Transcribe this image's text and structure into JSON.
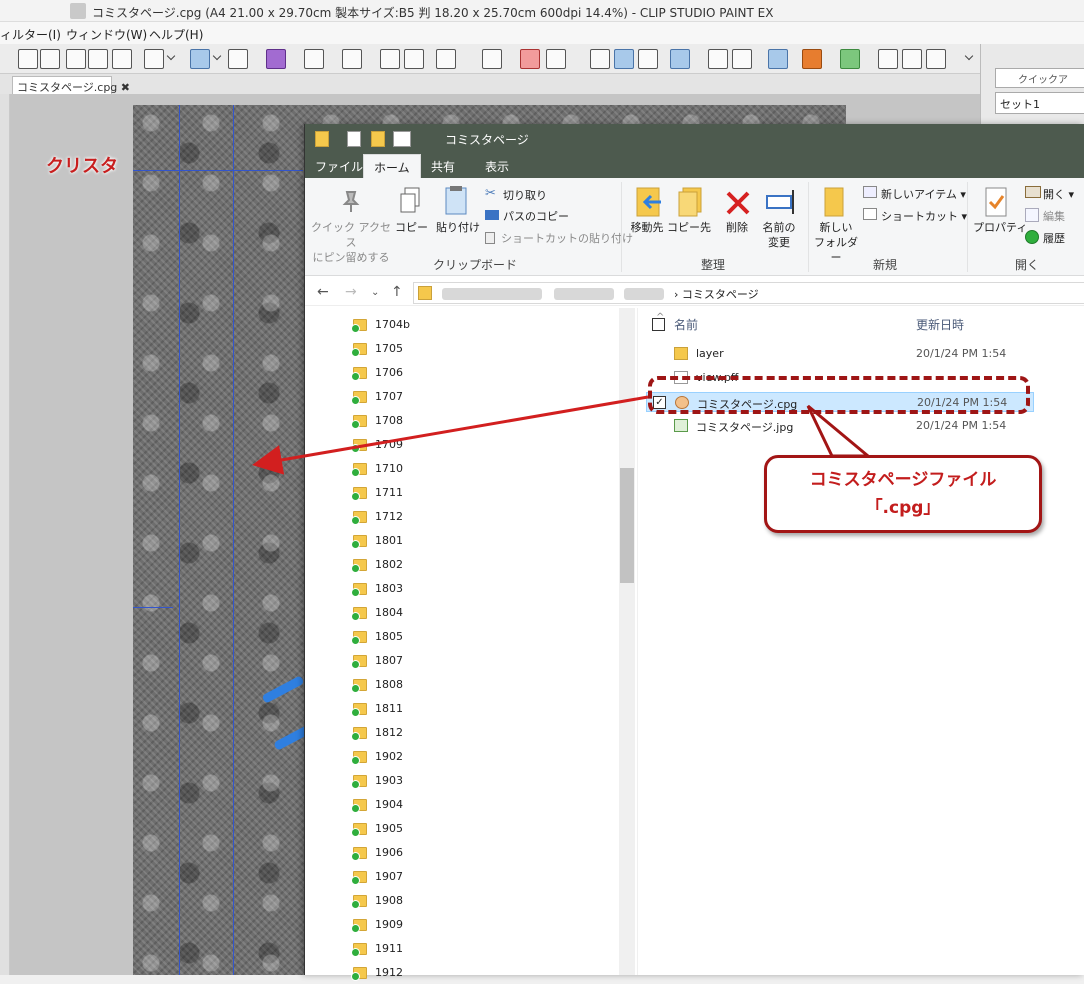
{
  "window": {
    "title": "コミスタページ.cpg (A4 21.00 x 29.70cm 製本サイズ:B5 判 18.20 x 25.70cm 600dpi 14.4%) - CLIP STUDIO PAINT EX"
  },
  "menu": {
    "items": [
      "ィルター(I)",
      "ウィンドウ(W)",
      "ヘルプ(H)"
    ]
  },
  "canvas": {
    "tab_label": "コミスタページ.cpg ✖"
  },
  "right_panel": {
    "search_placeholder": "クイックア",
    "set_label": "セット1"
  },
  "annotation": {
    "left_label": "クリスタ",
    "callout_line1": "コミスタページファイル",
    "callout_line2": "「.cpg」",
    "accent_color": "#c31d1d"
  },
  "explorer": {
    "title": "コミスタページ",
    "tabs": [
      "ファイル",
      "ホーム",
      "共有",
      "表示"
    ],
    "active_tab": "ホーム",
    "ribbon": {
      "clipboard": {
        "pin": "クイック アクセス\nにピン留めする",
        "copy": "コピー",
        "paste": "貼り付け",
        "cut": "切り取り",
        "copy_path": "パスのコピー",
        "paste_shortcut": "ショートカットの貼り付け",
        "group": "クリップボード"
      },
      "organize": {
        "move_to": "移動先",
        "copy_to": "コピー先",
        "delete": "削除",
        "rename": "名前の\n変更",
        "group": "整理"
      },
      "new": {
        "new_folder": "新しい\nフォルダー",
        "new_item": "新しいアイテム ▾",
        "shortcut": "ショートカット ▾",
        "group": "新規"
      },
      "open": {
        "properties": "プロパティ",
        "open": "開く ▾",
        "edit": "編集",
        "history": "履歴",
        "group": "開く"
      }
    },
    "address": {
      "crumb": "›  コミスタページ"
    },
    "nav_folders": [
      "1704b",
      "1705",
      "1706",
      "1707",
      "1708",
      "1709",
      "1710",
      "1711",
      "1712",
      "1801",
      "1802",
      "1803",
      "1804",
      "1805",
      "1807",
      "1808",
      "1811",
      "1812",
      "1902",
      "1903",
      "1904",
      "1905",
      "1906",
      "1907",
      "1908",
      "1909",
      "1911",
      "1912"
    ],
    "columns": {
      "name": "名前",
      "modified": "更新日時"
    },
    "files": [
      {
        "name": "layer",
        "date": "20/1/24 PM 1:54",
        "icon": "folder-icon"
      },
      {
        "name": "view.pff",
        "date": "",
        "icon": "file-icon"
      },
      {
        "name": "コミスタページ.cpg",
        "date": "20/1/24 PM 1:54",
        "icon": "clip-studio-file-icon",
        "selected": true
      },
      {
        "name": "コミスタページ.jpg",
        "date": "20/1/24 PM 1:54",
        "icon": "image-file-icon"
      }
    ]
  }
}
